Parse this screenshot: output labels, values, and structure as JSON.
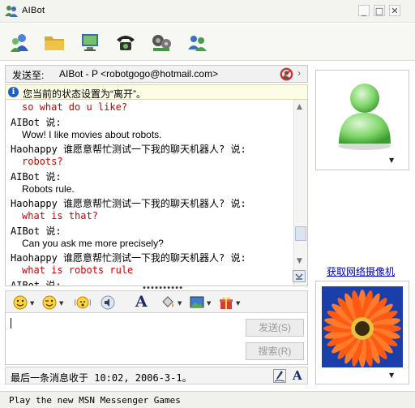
{
  "window": {
    "title": "AIBot",
    "controls": {
      "minimize": "_",
      "maximize": "□",
      "close": "✕"
    }
  },
  "toolbar": {
    "items": [
      {
        "icon": "invite-contact-icon"
      },
      {
        "icon": "send-file-icon"
      },
      {
        "icon": "video-icon"
      },
      {
        "icon": "voice-call-icon"
      },
      {
        "icon": "activities-icon"
      },
      {
        "icon": "games-icon"
      }
    ]
  },
  "to_bar": {
    "label": "发送至:",
    "value": "AIBot - P <robotgogo@hotmail.com>",
    "next": "›"
  },
  "notice": {
    "icon": "i",
    "text": "您当前的状态设置为“离开”。"
  },
  "conversation": {
    "lines": [
      {
        "type": "user",
        "text": "so what do u like?"
      },
      {
        "type": "sender",
        "text": "AIBot 说:"
      },
      {
        "type": "text",
        "text": "Wow! I like movies about robots."
      },
      {
        "type": "sender",
        "text": "Haohappy 谁愿意帮忙测试一下我的聊天机器人? 说:"
      },
      {
        "type": "user",
        "text": "robots?"
      },
      {
        "type": "sender",
        "text": "AIBot 说:"
      },
      {
        "type": "text",
        "text": "Robots rule."
      },
      {
        "type": "sender",
        "text": "Haohappy 谁愿意帮忙测试一下我的聊天机器人? 说:"
      },
      {
        "type": "user",
        "text": "what is that?"
      },
      {
        "type": "sender",
        "text": "AIBot 说:"
      },
      {
        "type": "text",
        "text": "Can you ask me more precisely?"
      },
      {
        "type": "sender",
        "text": "Haohappy 谁愿意帮忙测试一下我的聊天机器人? 说:"
      },
      {
        "type": "user",
        "text": "what is robots rule"
      },
      {
        "type": "sender",
        "text": "AIBot 说:"
      }
    ]
  },
  "format_bar": {
    "items": [
      "emoticon-icon",
      "wink-icon",
      "nudge-icon",
      "voice-clip-icon",
      "font-icon",
      "background-color-icon",
      "background-image-icon",
      "gift-icon"
    ],
    "font_glyph": "A"
  },
  "input": {
    "value": "",
    "send_label": "发送(S)",
    "search_label": "搜索(R)"
  },
  "status": {
    "last_message": "最后一条消息收于 10:02, 2006-3-1。",
    "font_glyph": "A"
  },
  "right_pane": {
    "webcam_link": "获取网络摄像机"
  },
  "footer": {
    "text": "Play the new MSN Messenger Games"
  },
  "colors": {
    "user_message": "#cc0000",
    "link": "#0000cc",
    "avatar_green": "#5fc95f",
    "flower_orange": "#ff5a14",
    "flower_bg": "#1b3fa8"
  }
}
